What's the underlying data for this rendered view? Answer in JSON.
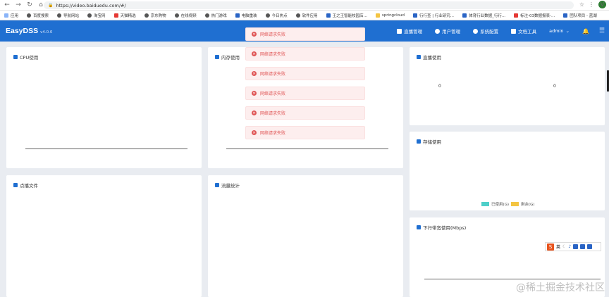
{
  "browser": {
    "url": "https://video.baiduedu.com/#/",
    "avatar_letter": "V",
    "bookmarks": [
      "应用",
      "百度搜索",
      "导航网站",
      "淘宝网",
      "天猫精选",
      "京东购物",
      "在线视频",
      "热门游戏",
      "电脑重装",
      "今日热点",
      "软件应用",
      "王之王智能校园店...",
      "springcloud",
      "行行查 | 行业研究...",
      "体育行业数据_行行...",
      "标注-03数据报表-...",
      "团队项目 - 蓝湖"
    ]
  },
  "app": {
    "brand": "EasyDSS",
    "version": "v4.0.0",
    "nav": [
      {
        "label": "直播管理"
      },
      {
        "label": "用户管理"
      },
      {
        "label": "系统配置"
      },
      {
        "label": "文档工具"
      },
      {
        "label": "admin"
      }
    ]
  },
  "cards": {
    "cpu": {
      "title": "CPU使用"
    },
    "memory": {
      "title": "内存使用"
    },
    "live": {
      "title": "直播使用",
      "value_left": "0",
      "value_right": "0"
    },
    "storage": {
      "title": "存储使用",
      "legend_used": "已使用(G)",
      "legend_free": "剩余(G)"
    },
    "vod": {
      "title": "点播文件"
    },
    "traffic": {
      "title": "流量统计"
    },
    "bandwidth": {
      "title": "下行带宽使用(Mbps)"
    }
  },
  "toasts": [
    "网络请求失败",
    "网络请求失败",
    "网络请求失败",
    "网络请求失败",
    "网络请求失败",
    "网络请求失败"
  ],
  "ime": {
    "lang": "英"
  },
  "watermark": "@稀土掘金技术社区",
  "colors": {
    "accent": "#1f6fd1",
    "error": "#e05757",
    "used": "#4ecfc9",
    "free": "#f4c542"
  }
}
